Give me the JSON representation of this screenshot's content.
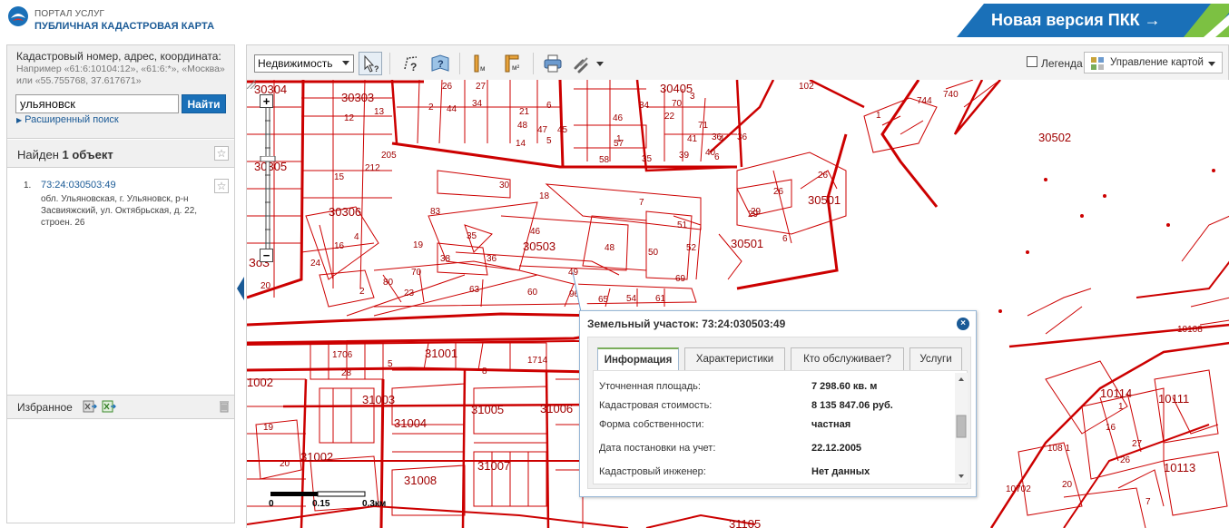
{
  "header": {
    "portal_line1": "ПОРТАЛ УСЛУГ",
    "portal_line2": "ПУБЛИЧНАЯ КАДАСТРОВАЯ КАРТА",
    "new_version": "Новая версия ПКК →"
  },
  "search": {
    "prompt": "Кадастровый номер, адрес, координата:",
    "hint": "Например «61:6:10104:12», «61:6:*», «Москва» или «55.755768, 37.617671»",
    "value": "ульяновск",
    "find_button": "Найти",
    "advanced_link": "Расширенный поиск"
  },
  "results": {
    "found_prefix": "Найден ",
    "found_count": "1 объект",
    "items": [
      {
        "num": "1.",
        "id": "73:24:030503:49",
        "address": "обл. Ульяновская, г. Ульяновск, р-н Засвияжский, ул. Октябрьская, д. 22, строен. 26"
      }
    ]
  },
  "favorites": {
    "title": "Избранное"
  },
  "toolbar": {
    "layer_select": "Недвижимость",
    "legend_label": "Легенда",
    "map_control": "Управление картой"
  },
  "map": {
    "labels": [
      "30304",
      "30303",
      "26",
      "27",
      "30405",
      "70",
      "102",
      "744",
      "740",
      "1",
      "12",
      "13",
      "2",
      "44",
      "34",
      "21",
      "6",
      "46",
      "34",
      "22",
      "3",
      "71",
      "48",
      "47",
      "45",
      "1",
      "5",
      "14",
      "4",
      "30502",
      "57",
      "41",
      "6",
      "36",
      "58",
      "35",
      "39",
      "40",
      "36",
      "30",
      "18",
      "7",
      "26",
      "30501",
      "15",
      "212",
      "205",
      "26",
      "29",
      "30306",
      "83",
      "46",
      "51",
      "35",
      "48",
      "50",
      "52",
      "16",
      "4",
      "24",
      "30503",
      "30501",
      "29",
      "6",
      "19",
      "38",
      "36",
      "69",
      "70",
      "80",
      "2",
      "23",
      "49",
      "63",
      "60",
      "96",
      "65",
      "54",
      "61",
      "20",
      "1706",
      "31001",
      "1714",
      "28",
      "5",
      "8",
      "31003",
      "31005",
      "31006",
      "31004",
      "19",
      "31002",
      "20",
      "31008",
      "31007",
      "31105",
      "10108",
      "10114",
      "10111",
      "1",
      "16",
      "27",
      "108 1",
      "26",
      "20",
      "10113",
      "7",
      "10702",
      "1002",
      "30305",
      "ЗоЗ"
    ],
    "scale_labels": [
      "0",
      "0.15",
      "0.3км"
    ]
  },
  "popup": {
    "title": "Земельный участок: 73:24:030503:49",
    "tabs": [
      "Информация",
      "Характеристики",
      "Кто обслуживает?",
      "Услуги"
    ],
    "rows": [
      {
        "key": "Уточненная площадь:",
        "value": "7 298.60 кв. м"
      },
      {
        "key": "Кадастровая стоимость:",
        "value": "8 135 847.06 руб."
      },
      {
        "key": "Форма собственности:",
        "value": "частная"
      },
      {
        "key": "Дата постановки на учет:",
        "value": "22.12.2005"
      },
      {
        "key": "Кадастровый инженер:",
        "value": "Нет данных"
      }
    ]
  },
  "colors": {
    "brand_blue": "#1a70b8",
    "map_line": "#cc0000",
    "accent_green": "#7aad5b"
  }
}
